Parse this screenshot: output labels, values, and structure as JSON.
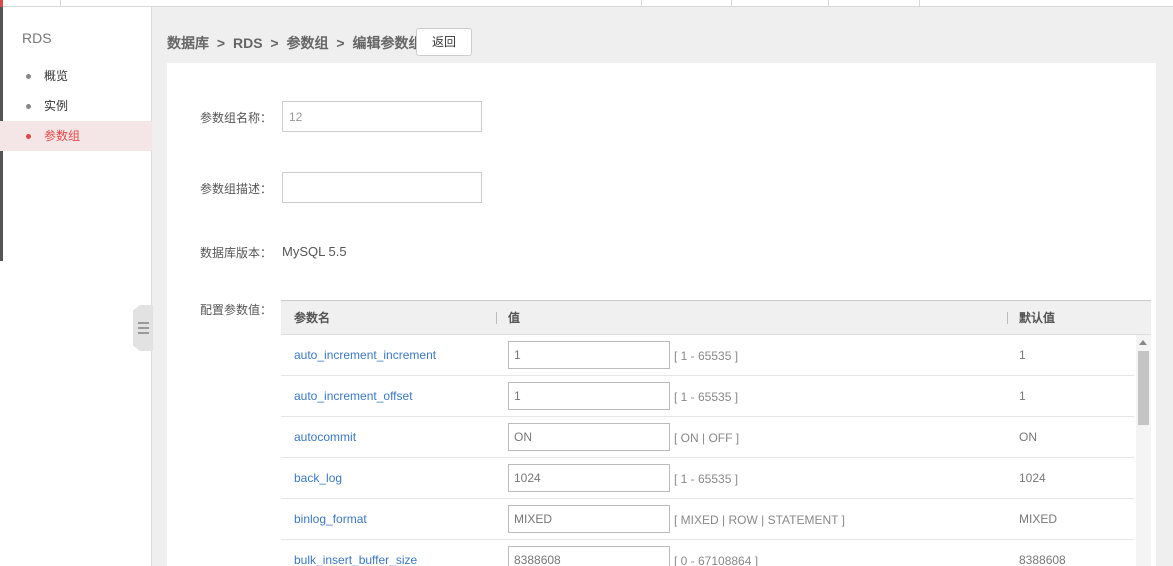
{
  "sidebar": {
    "title": "RDS",
    "items": [
      {
        "label": "概览"
      },
      {
        "label": "实例"
      },
      {
        "label": "参数组"
      }
    ]
  },
  "breadcrumb": {
    "items": [
      "数据库",
      "RDS",
      "参数组",
      "编辑参数组"
    ],
    "separator": ">"
  },
  "back_label": "返回",
  "form": {
    "name_label": "参数组名称：",
    "name_value": "12",
    "desc_label": "参数组描述：",
    "desc_value": "",
    "version_label": "数据库版本：",
    "version_value": "MySQL 5.5",
    "params_label": "配置参数值："
  },
  "table": {
    "headers": {
      "name": "参数名",
      "value": "值",
      "default": "默认值"
    },
    "rows": [
      {
        "name": "auto_increment_increment",
        "value": "1",
        "range": "[ 1 - 65535 ]",
        "default": "1"
      },
      {
        "name": "auto_increment_offset",
        "value": "1",
        "range": "[ 1 - 65535 ]",
        "default": "1"
      },
      {
        "name": "autocommit",
        "value": "ON",
        "range": "[ ON | OFF ]",
        "default": "ON"
      },
      {
        "name": "back_log",
        "value": "1024",
        "range": "[ 1 - 65535 ]",
        "default": "1024"
      },
      {
        "name": "binlog_format",
        "value": "MIXED",
        "range": "[ MIXED | ROW | STATEMENT ]",
        "default": "MIXED"
      },
      {
        "name": "bulk_insert_buffer_size",
        "value": "8388608",
        "range": "[ 0 - 67108864 ]",
        "default": "8388608"
      }
    ]
  },
  "colors": {
    "accent": "#e04848",
    "link": "#3b78c4",
    "active_bg": "#f4e6e6"
  }
}
